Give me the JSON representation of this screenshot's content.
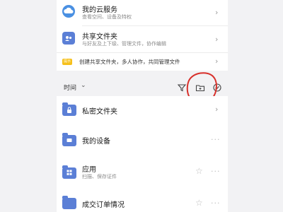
{
  "top": {
    "cloud": {
      "title": "我的云服务",
      "subtitle": "查看空间、设备及特权",
      "icon": "cloud-icon"
    },
    "shared": {
      "title": "共享文件夹",
      "subtitle": "与好友及上下级、管理文件，协作编辑",
      "icon": "shared-folder-icon"
    },
    "tip": {
      "badge": "提示",
      "text": "创建共享文件夹，多人协作，共同管理文件"
    }
  },
  "sortbar": {
    "label": "时间",
    "caret": "⌄"
  },
  "items": [
    {
      "title": "私密文件夹",
      "subtitle": "",
      "icon": "lock-icon"
    },
    {
      "title": "我的设备",
      "subtitle": "",
      "icon": "device-icon"
    },
    {
      "title": "应用",
      "subtitle": "扫描、保存证件",
      "icon": "apps-icon"
    },
    {
      "title": "成交订单情况",
      "subtitle": "",
      "icon": "folder-icon"
    }
  ],
  "colors": {
    "accent": "#5b7fd6",
    "cloud": "#4a90e2",
    "badge": "#f6c01b",
    "annotation": "#d8302b"
  }
}
